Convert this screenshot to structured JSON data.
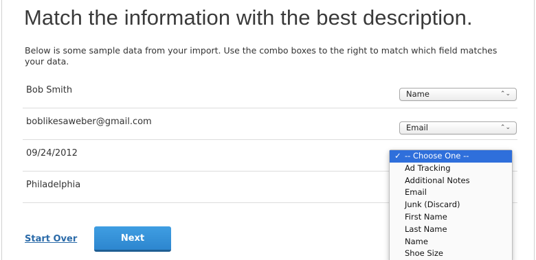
{
  "page": {
    "title": "Match the information with the best description.",
    "intro": "Below is some sample data from your import. Use the combo boxes to the right to match which field matches your data."
  },
  "rows": [
    {
      "value": "Bob Smith",
      "selected": "Name"
    },
    {
      "value": "boblikesaweber@gmail.com",
      "selected": "Email"
    },
    {
      "value": "09/24/2012",
      "selected": "-- Choose One --"
    },
    {
      "value": "Philadelphia",
      "selected": ""
    }
  ],
  "dropdown": {
    "check": "✓",
    "options": [
      "-- Choose One --",
      "Ad Tracking",
      "Additional Notes",
      "Email",
      "Junk (Discard)",
      "First Name",
      "Last Name",
      "Name",
      "Shoe Size"
    ],
    "selected_option": "-- Choose One --"
  },
  "combo_arrows": "⌃⌄",
  "actions": {
    "start_over_label": "Start Over",
    "next_label": "Next"
  },
  "colors": {
    "link": "#2a6aa8",
    "button": "#3596dc",
    "selection": "#2f6fdb"
  }
}
